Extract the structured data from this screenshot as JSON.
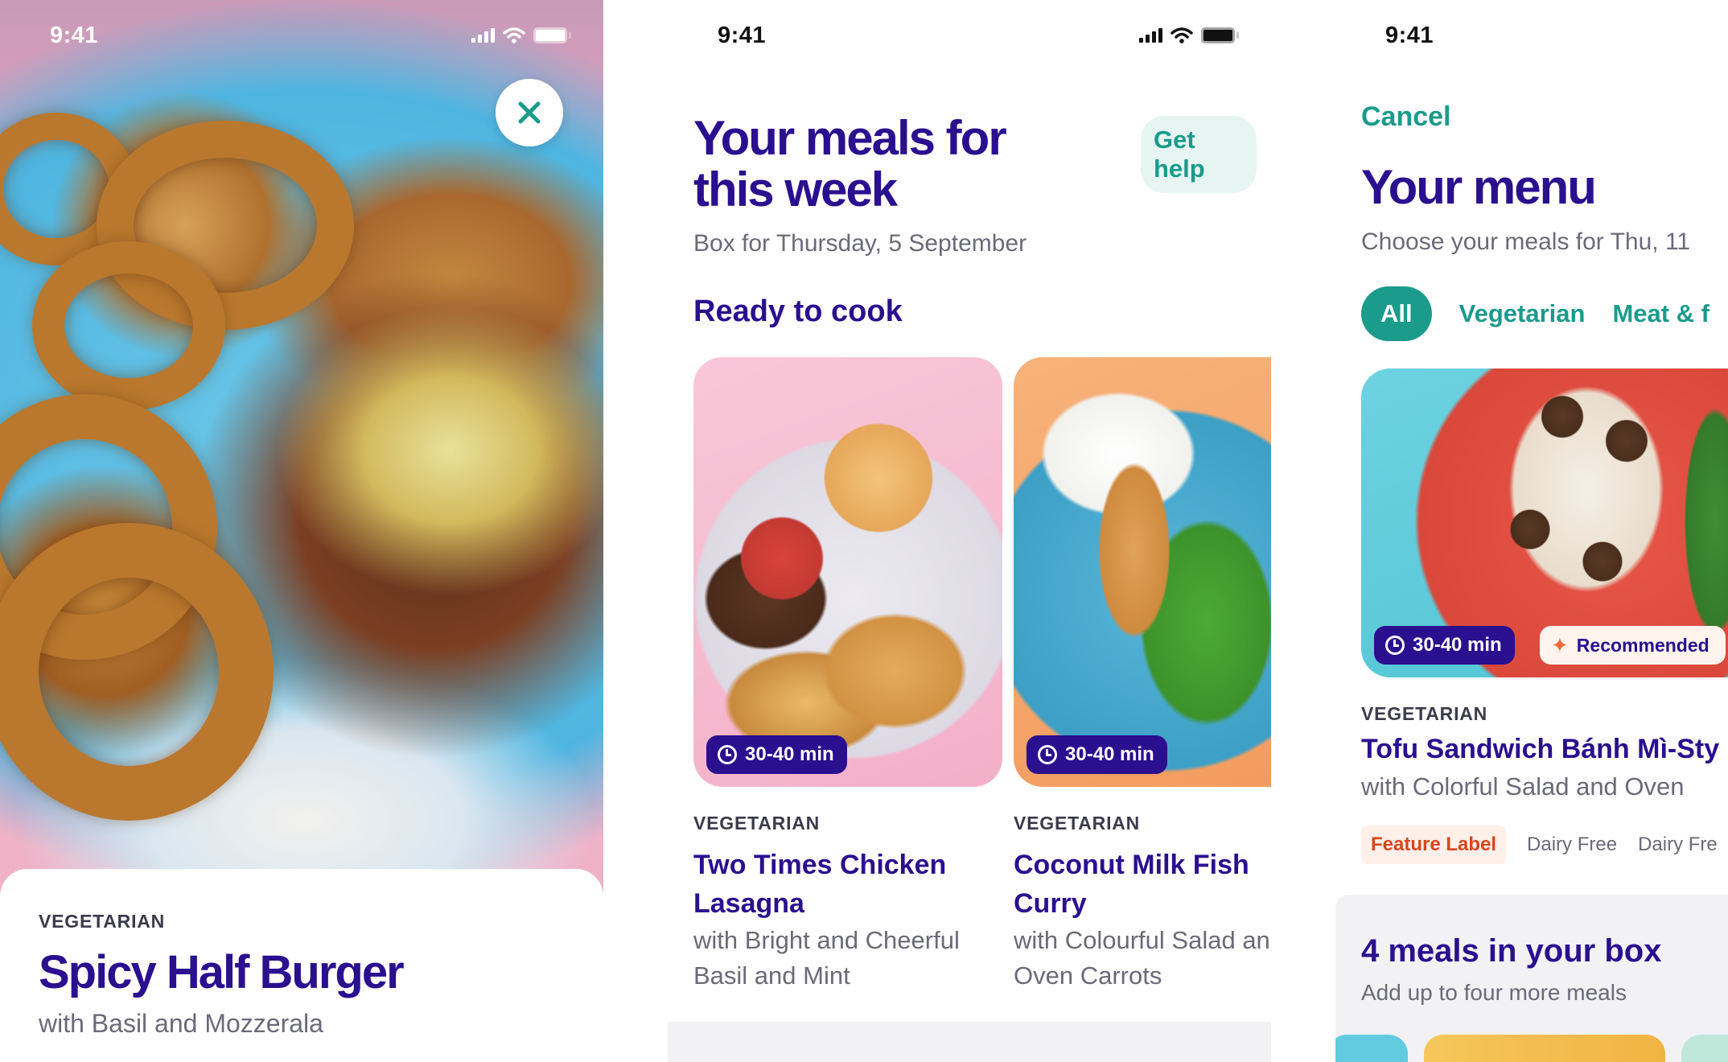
{
  "screens": {
    "detail": {
      "status": {
        "time": "9:41"
      },
      "close_icon": "close-icon",
      "category": "VEGETARIAN",
      "title": "Spicy Half Burger",
      "subtitle": "with Basil and Mozzerala"
    },
    "meals": {
      "status": {
        "time": "9:41"
      },
      "title": "Your meals for this week",
      "help_label": "Get help",
      "box_date": "Box for Thursday, 5 September",
      "section_title": "Ready to cook",
      "cards": [
        {
          "time": "30-40 min",
          "category": "VEGETARIAN",
          "title": "Two Times Chicken Lasagna",
          "subtitle_line1": "with Bright and Cheerful",
          "subtitle_line2": "Basil and Mint"
        },
        {
          "time": "30-40 min",
          "category": "VEGETARIAN",
          "title": "Coconut Milk Fish Curry",
          "subtitle_line1": "with Colourful Salad and",
          "subtitle_line2": "Oven Carrots"
        }
      ]
    },
    "menu": {
      "status": {
        "time": "9:41"
      },
      "cancel_label": "Cancel",
      "title": "Your menu",
      "subtitle": "Choose your meals for Thu, 11",
      "filters": [
        "All",
        "Vegetarian",
        "Meat & f"
      ],
      "feature": {
        "time": "30-40 min",
        "recommended": "Recommended",
        "category": "VEGETARIAN",
        "title": "Tofu Sandwich Bánh Mì-Sty",
        "subtitle": "with Colorful Salad and Oven",
        "tags": [
          "Feature Label",
          "Dairy Free",
          "Dairy Fre"
        ]
      },
      "box": {
        "title": "4 meals in your box",
        "subtitle": "Add up to four more meals"
      }
    }
  },
  "colors": {
    "brand_purple": "#2a0f8f",
    "teal": "#1a9b8b",
    "feature_orange": "#d9461a",
    "muted": "#6a6a78"
  }
}
